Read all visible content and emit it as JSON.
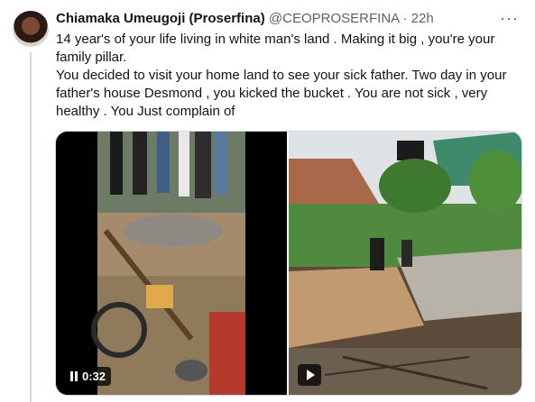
{
  "author": {
    "display_name": "Chiamaka Umeugoji (Proserfina)",
    "handle": "@CEOPROSERFINA",
    "separator": "·",
    "time": "22h",
    "more_label": "···"
  },
  "tweet": {
    "paragraph_1": "14 year's of your life living in white man's land . Making it big , you're your family pillar.",
    "paragraph_2": "You decided to visit your home land to see your sick father. Two day in your father's house Desmond , you kicked the bucket . You are not sick , very healthy . You Just complain of"
  },
  "media": {
    "left_video": {
      "duration": "0:32",
      "state_icon": "pause-icon"
    },
    "right_video": {
      "state_icon": "play-icon"
    }
  },
  "colors": {
    "text": "#0f1419",
    "secondary": "#536471",
    "border": "#cfd9de"
  }
}
